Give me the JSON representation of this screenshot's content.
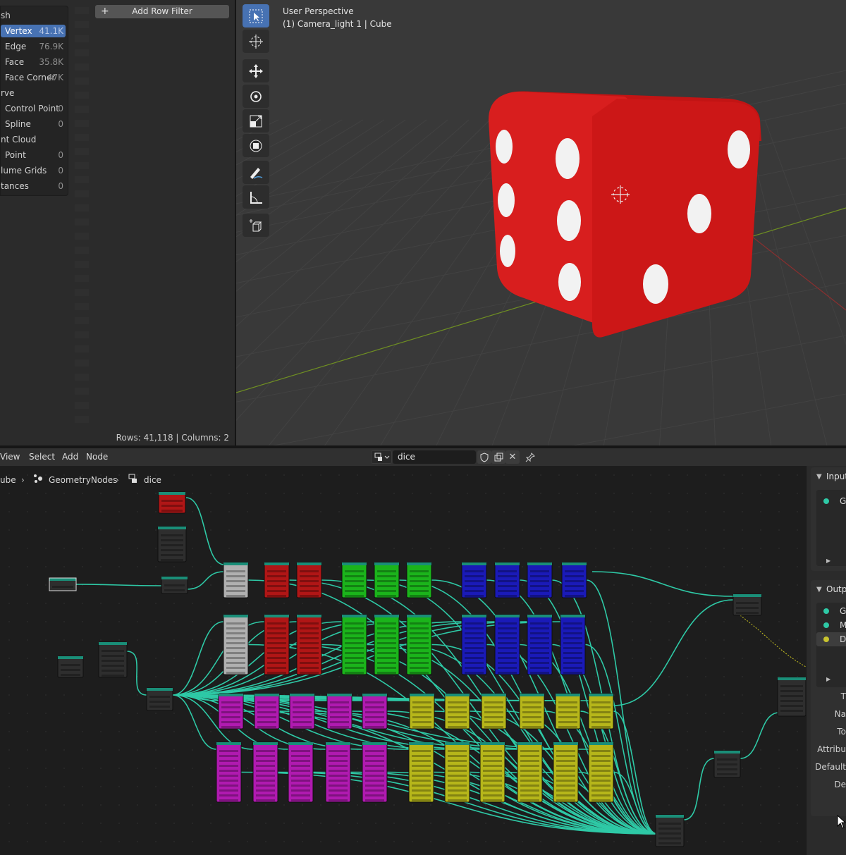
{
  "spreadsheet": {
    "domains": [
      {
        "label": "sh",
        "count": "",
        "indent": 0,
        "selected": false
      },
      {
        "label": "Vertex",
        "count": "41.1K",
        "indent": 1,
        "selected": true
      },
      {
        "label": "Edge",
        "count": "76.9K",
        "indent": 1,
        "selected": false
      },
      {
        "label": "Face",
        "count": "35.8K",
        "indent": 1,
        "selected": false
      },
      {
        "label": "Face Corner",
        "count": "47K",
        "indent": 1,
        "selected": false
      },
      {
        "label": "rve",
        "count": "",
        "indent": 0,
        "selected": false
      },
      {
        "label": "Control Point",
        "count": "0",
        "indent": 1,
        "selected": false
      },
      {
        "label": "Spline",
        "count": "0",
        "indent": 1,
        "selected": false
      },
      {
        "label": "nt Cloud",
        "count": "",
        "indent": 0,
        "selected": false
      },
      {
        "label": "Point",
        "count": "0",
        "indent": 1,
        "selected": false
      },
      {
        "label": "lume Grids",
        "count": "0",
        "indent": 0,
        "selected": false
      },
      {
        "label": "tances",
        "count": "0",
        "indent": 0,
        "selected": false
      }
    ],
    "add_filter_label": "Add Row Filter",
    "status": "Rows: 41,118   |   Columns: 2"
  },
  "viewport": {
    "perspective": "User Perspective",
    "object_info": "(1) Camera_light 1 | Cube",
    "tools": [
      {
        "icon": "select-box-icon",
        "active": true
      },
      {
        "icon": "cursor-icon",
        "active": false
      },
      {
        "icon": "move-icon",
        "active": false
      },
      {
        "icon": "rotate-icon",
        "active": false
      },
      {
        "icon": "scale-icon",
        "active": false
      },
      {
        "icon": "transform-icon",
        "active": false
      },
      {
        "icon": "annotate-icon",
        "active": false
      },
      {
        "icon": "measure-icon",
        "active": false
      },
      {
        "icon": "add-cube-icon",
        "active": false
      }
    ],
    "dice_color": "#d81e1e",
    "pip_color": "#f2f2f2"
  },
  "node_editor": {
    "menus": [
      "View",
      "Select",
      "Add",
      "Node"
    ],
    "node_group_name": "dice",
    "breadcrumb": [
      "ube",
      "GeometryNodes",
      "dice"
    ],
    "link_color": "#2ec9a6",
    "node_colors": {
      "red": "#b01616",
      "grey": "#b0b0b0",
      "green": "#1bb41b",
      "blue": "#1a1ab8",
      "magenta": "#b01ab0",
      "olive": "#b6b61a",
      "dark": "#2e2e2e"
    }
  },
  "sidebar": {
    "inputs_title": "Inputs",
    "input_items": [
      {
        "label": "G",
        "color": "#2ec9a6"
      }
    ],
    "outputs_title": "Outpu",
    "output_items": [
      {
        "label": "G",
        "color": "#2ec9a6"
      },
      {
        "label": "M",
        "color": "#2ec9a6"
      },
      {
        "label": "D",
        "color": "#c9c42e"
      }
    ],
    "props": [
      "T",
      "Na",
      "To",
      "Attribu",
      "Default ",
      "De"
    ]
  }
}
